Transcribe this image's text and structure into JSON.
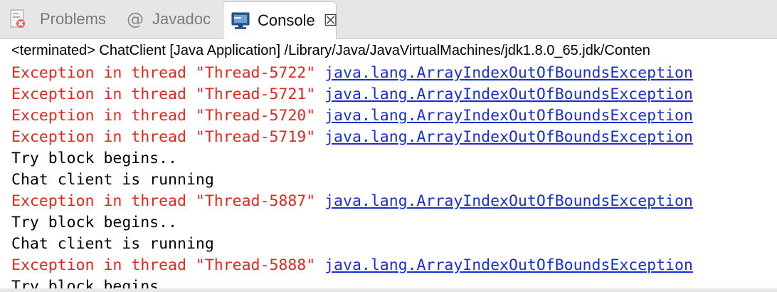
{
  "tabs": {
    "problems": "Problems",
    "javadoc": "Javadoc",
    "console": "Console"
  },
  "status_text": "<terminated> ChatClient [Java Application] /Library/Java/JavaVirtualMachines/jdk1.8.0_65.jdk/Conten",
  "colors": {
    "error": "#e5271f",
    "link": "#1a2fd1",
    "stdout": "#000000"
  },
  "lines": [
    {
      "prefix": "Exception in thread \"Thread-5722\" ",
      "link": "java.lang.ArrayIndexOutOfBoundsException"
    },
    {
      "prefix": "Exception in thread \"Thread-5721\" ",
      "link": "java.lang.ArrayIndexOutOfBoundsException"
    },
    {
      "prefix": "Exception in thread \"Thread-5720\" ",
      "link": "java.lang.ArrayIndexOutOfBoundsException"
    },
    {
      "prefix": "Exception in thread \"Thread-5719\" ",
      "link": "java.lang.ArrayIndexOutOfBoundsException"
    },
    {
      "text": "Try block begins.."
    },
    {
      "text": "Chat client is running"
    },
    {
      "prefix": "Exception in thread \"Thread-5887\" ",
      "link": "java.lang.ArrayIndexOutOfBoundsException"
    },
    {
      "text": "Try block begins.."
    },
    {
      "text": "Chat client is running"
    },
    {
      "prefix": "Exception in thread \"Thread-5888\" ",
      "link": "java.lang.ArrayIndexOutOfBoundsException"
    },
    {
      "text": "Try block begins.."
    }
  ]
}
